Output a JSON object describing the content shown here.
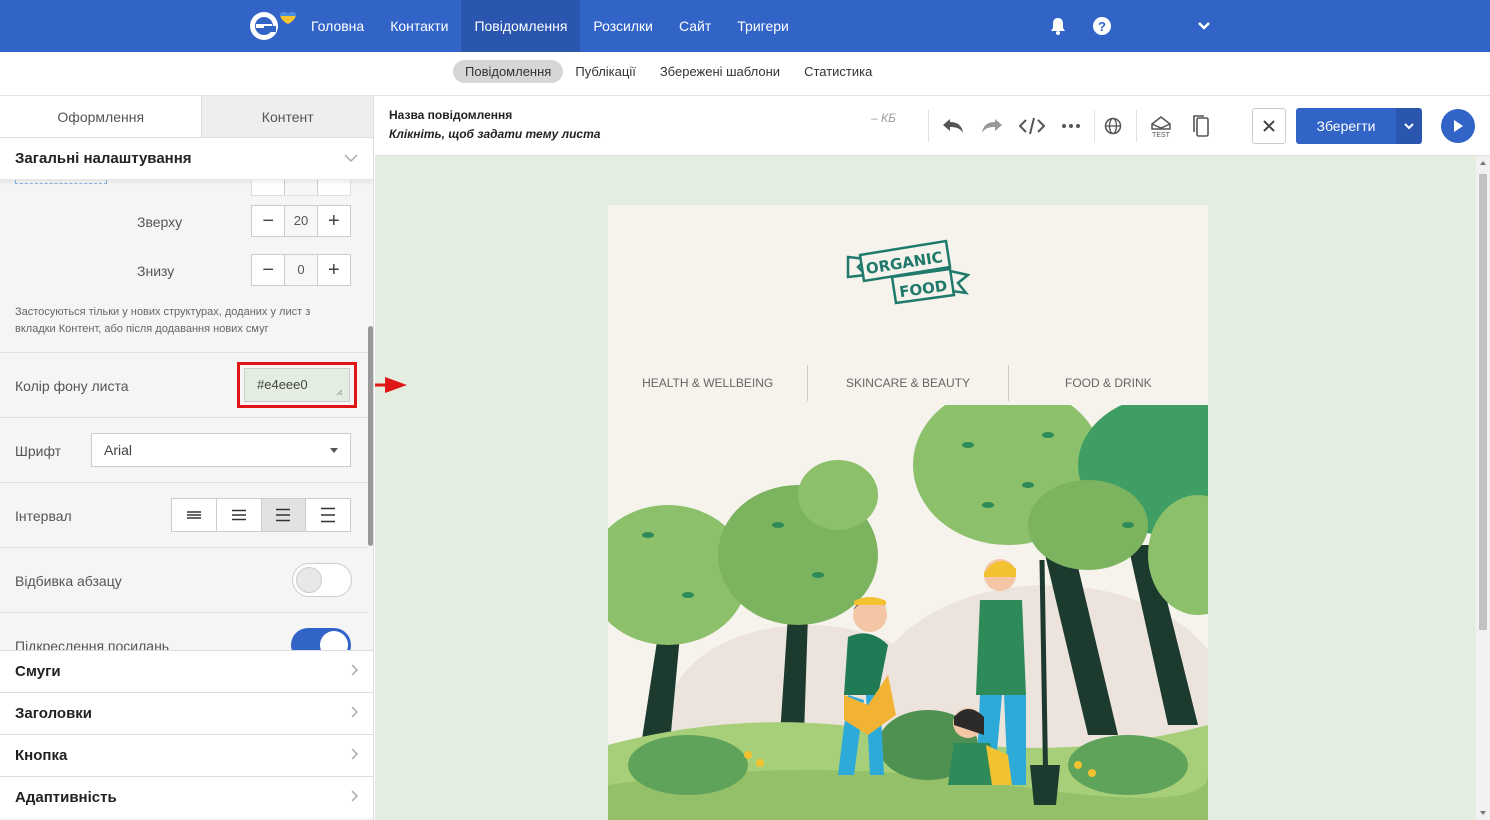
{
  "topnav": {
    "items": [
      "Головна",
      "Контакти",
      "Повідомлення",
      "Розсилки",
      "Сайт",
      "Тригери"
    ],
    "active_index": 2,
    "icons": [
      "bell-icon",
      "help-icon",
      "chevron-down-icon"
    ]
  },
  "subnav": {
    "items": [
      "Повідомлення",
      "Публікації",
      "Збережені шаблони",
      "Статистика"
    ],
    "active_index": 0
  },
  "panel": {
    "tabs": [
      "Оформлення",
      "Контент"
    ],
    "active_tab": 0,
    "section_title": "Загальні налаштування",
    "padding_top_label": "Зверху",
    "padding_top_value": "20",
    "padding_bottom_label": "Знизу",
    "padding_bottom_value": "0",
    "hint": "Застосуються тільки у нових структурах, доданих у лист з вкладки Контент, або після додавання нових смуг",
    "bg_color_label": "Колір фону листа",
    "bg_color_value": "#e4eee0",
    "font_label": "Шрифт",
    "font_value": "Arial",
    "spacing_label": "Інтервал",
    "spacing_active_index": 2,
    "paragraph_label": "Відбивка абзацу",
    "paragraph_on": false,
    "underline_label": "Підкреслення посилань",
    "underline_on": true,
    "accordion": [
      "Смуги",
      "Заголовки",
      "Кнопка",
      "Адаптивність"
    ]
  },
  "editor": {
    "message_name": "Назва повідомлення",
    "subject_placeholder": "Клікніть, щоб задати тему листа",
    "size": "– КБ",
    "save_label": "Зберегти",
    "test_label": "TEST"
  },
  "email": {
    "logo_line1": "ORGANIC",
    "logo_line2": "FOOD",
    "nav": [
      "HEALTH & WELLBEING",
      "SKINCARE & BEAUTY",
      "FOOD & DRINK"
    ]
  },
  "colors": {
    "brand": "#3264c8",
    "canvas_bg": "#e4eee0",
    "highlight": "#e01515",
    "logo_teal": "#1f7a6c"
  }
}
